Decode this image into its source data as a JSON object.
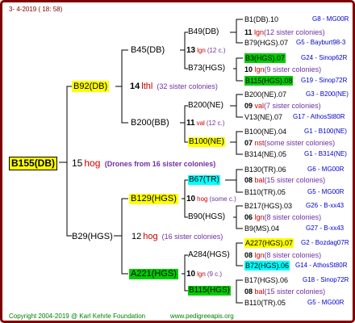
{
  "header": {
    "date": "3-  4-2019 ( 18:  58)"
  },
  "footer": {
    "copyright": "Copyright 2004-2019 @ Karl Kehrle Foundation",
    "site": "www.pedigreeapis.org"
  },
  "root": {
    "id": "B155(DB)",
    "gen": "15",
    "type": "hog",
    "note": "(Drones from 16 sister colonies)"
  },
  "gen1": {
    "top": {
      "id": "B92(DB)",
      "gen": "14",
      "type": "lthl",
      "note": "(32 sister colonies)"
    },
    "bottom": {
      "id": "B29(HGS)",
      "gen": "12",
      "type": "hog",
      "note": "(16 sister colonies)"
    }
  },
  "gen2": {
    "a": {
      "id": "B45(DB)",
      "gen": "13",
      "type": "lgn",
      "note": "(12 c.)"
    },
    "b": {
      "id": "B200(BB)",
      "gen": "11",
      "type": "val",
      "note": "(12 c.)"
    },
    "c": {
      "id": "B129(HGS)",
      "gen": "10",
      "type": "hog",
      "note": "(some c.)"
    },
    "d": {
      "id": "A221(HGS)",
      "gen": "10",
      "type": "lgn",
      "note": "(9 c.)"
    }
  },
  "gen3": {
    "a": {
      "id": "B49(DB)",
      "gen": "11",
      "type": "lgn",
      "note": "(12 sister colonies)"
    },
    "b": {
      "id": "B73(HGS)",
      "gen": "10",
      "type": "lgn",
      "note": "(9 sister colonies)"
    },
    "c": {
      "id": "B200(NE)",
      "gen": "09",
      "type": "val",
      "note": "(7 sister colonies)"
    },
    "d": {
      "id": "B100(NE)",
      "gen": "07",
      "type": "nst",
      "note": "(some sister colonies)"
    },
    "e": {
      "id": "B67(TR)",
      "gen": "08",
      "type": "bal",
      "note": "(15 sister colonies)"
    },
    "f": {
      "id": "B90(HGS)",
      "gen": "06",
      "type": "lgn",
      "note": "(8 sister colonies)"
    },
    "g": {
      "id": "A284(HGS)",
      "gen": "08",
      "type": "lgn",
      "note": "(8 sister colonies)"
    },
    "h": {
      "id": "B115(HGS)",
      "gen": "08",
      "type": "bal",
      "note": "(15 sister colonies)"
    }
  },
  "gen4": [
    {
      "id": "B1(DB).10",
      "code": "G8 - MG00R"
    },
    {
      "id": "B79(HGS).07",
      "code": "G5 - Bayburt98-3"
    },
    {
      "id": "B3(HGS).07",
      "code": "G24 - Sinop62R"
    },
    {
      "id": "B115(HGS).08",
      "code": "G19 - Sinop72R"
    },
    {
      "id": "B200(NE).07",
      "code": "G3 - B200(NE)"
    },
    {
      "id": "V13(NE).07",
      "code": "G17 - AthosSt80R"
    },
    {
      "id": "B100(NE).04",
      "code": "G1 - B100(NE)"
    },
    {
      "id": "B314(NE).05",
      "code": "G1 - B314(NE)"
    },
    {
      "id": "B130(TR).06",
      "code": "G6 - MG00R"
    },
    {
      "id": "B110(TR).05",
      "code": "G5 - MG00R"
    },
    {
      "id": "B217(HGS).03",
      "code": "G26 - B-xx43"
    },
    {
      "id": "B9(MS).04",
      "code": "G27 - B-xx43"
    },
    {
      "id": "A227(HGS).07",
      "code": "G2 - Bozdag07R"
    },
    {
      "id": "B72(HGS).06",
      "code": "G14 - AthosSt80R"
    },
    {
      "id": "B17(HGS).06",
      "code": "G18 - Sinop72R"
    },
    {
      "id": "B110(TR).05",
      "code": "G5 - MG00R"
    }
  ],
  "colors": {
    "frame": "#800000",
    "line": "#000000",
    "yellow": "#ffff00",
    "green": "#00cc00",
    "cyan": "#00ffff",
    "red": "#cc0000",
    "blue": "#0000cc",
    "purple": "#7030a0"
  }
}
